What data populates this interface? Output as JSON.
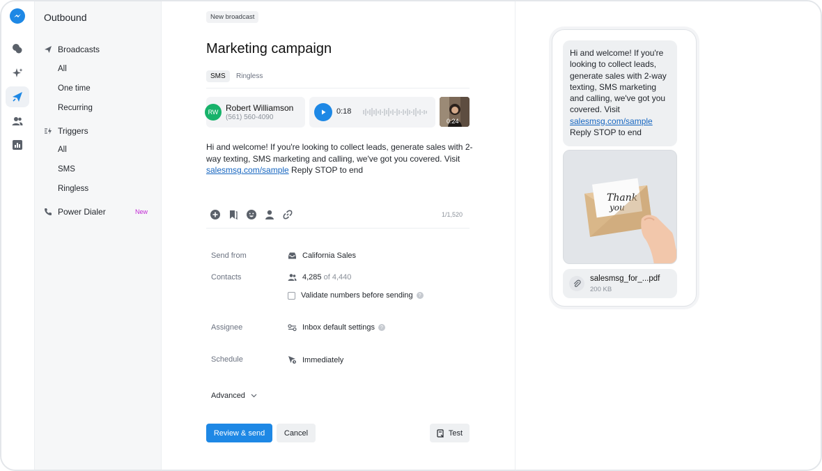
{
  "nav": {
    "title": "Outbound",
    "broadcasts": {
      "label": "Broadcasts",
      "items": [
        "All",
        "One time",
        "Recurring"
      ]
    },
    "triggers": {
      "label": "Triggers",
      "items": [
        "All",
        "SMS",
        "Ringless"
      ]
    },
    "power_dialer": {
      "label": "Power Dialer",
      "badge": "New"
    }
  },
  "main": {
    "breadcrumb": "New broadcast",
    "title": "Marketing campaign",
    "tabs": [
      "SMS",
      "Ringless"
    ],
    "contact": {
      "initials": "RW",
      "name": "Robert Williamson",
      "phone": "(561) 560-4090"
    },
    "audio": {
      "duration": "0:18"
    },
    "video": {
      "duration": "0:24"
    },
    "message": {
      "text_before": "Hi and welcome! If you're looking to collect leads, generate sales with 2-way texting, SMS marketing and calling, we've got you covered. Visit ",
      "link": "salesmsg.com/sample",
      "text_after": " Reply STOP to end"
    },
    "char_count": "1/1,520",
    "fields": {
      "send_from": {
        "label": "Send from",
        "value": "California Sales"
      },
      "contacts": {
        "label": "Contacts",
        "count": "4,285",
        "of_total": "of 4,440",
        "validate_label": "Validate numbers before sending"
      },
      "assignee": {
        "label": "Assignee",
        "value": "Inbox default settings"
      },
      "schedule": {
        "label": "Schedule",
        "value": "Immediately"
      }
    },
    "advanced_label": "Advanced",
    "buttons": {
      "review": "Review & send",
      "cancel": "Cancel",
      "test": "Test"
    }
  },
  "preview": {
    "message": {
      "text_before": "Hi and welcome! If you're looking to collect leads, generate sales with 2-way texting, SMS marketing and calling, we've got you covered. Visit ",
      "link": "salesmsg.com/sample",
      "text_after": "Reply STOP to end"
    },
    "image_text_1": "Thank",
    "image_text_2": "you",
    "file": {
      "name": "salesmsg_for_...pdf",
      "size": "200 KB"
    }
  },
  "colors": {
    "accent": "#1e88e5",
    "badge": "#c026d3",
    "avatar": "#17b26a"
  }
}
